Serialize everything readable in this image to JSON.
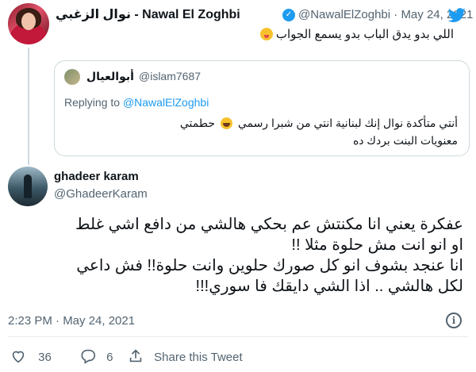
{
  "tweet": {
    "display_name": "نوال الزغبي - Nawal El Zoghbi",
    "handle_date": "@NawalElZoghbi · May 24, 2021",
    "text": "اللي بدو يدق الباب بدو يسمع الجواب",
    "emoji": "winking-face-tongue"
  },
  "quoted": {
    "display_name": "أبوالعيال",
    "handle": "@islam7687",
    "replying_prefix": "Replying to ",
    "replying_mention": "@NawalElZoghbi",
    "line1_a": "أنتي متأكدة نوال إنك لبنانية انتي من شبرا رسمي",
    "line1_b": "حطمتي",
    "line2": "معنويات البنت بردك ده",
    "emoji": "face-with-tears-of-joy"
  },
  "reply": {
    "display_name": "ghadeer karam",
    "handle": "@GhadeerKaram",
    "lines": [
      "عفكرة يعني انا مكنتش عم بحكي هالشي من دافع اشي غلط",
      "او انو انت مش حلوة مثلا !!",
      "انا عنجد بشوف انو كل صورك حلوين وانت حلوة!! فش داعي",
      "لكل هالشي .. اذا الشي دايقك فا سوري!!!"
    ],
    "timestamp": "2:23 PM · May 24, 2021"
  },
  "actions": {
    "likes": "36",
    "replies": "6",
    "share_label": "Share this Tweet"
  },
  "colors": {
    "accent": "#1d9bf0",
    "secondary_text": "#536471",
    "border": "#cfd9de"
  },
  "icons": [
    "twitter-bird-icon",
    "verified-badge-icon",
    "info-icon",
    "heart-icon",
    "reply-icon",
    "share-icon"
  ]
}
